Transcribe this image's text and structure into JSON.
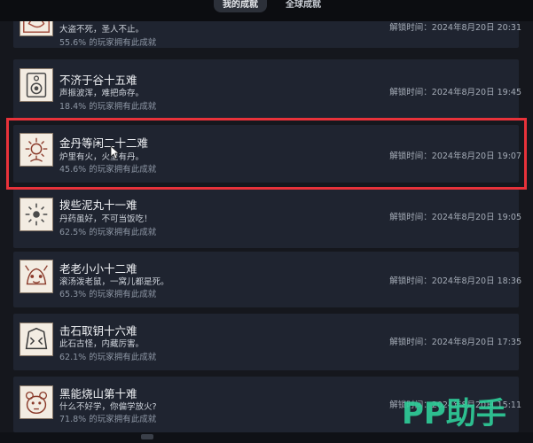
{
  "tabs": {
    "mine": "我的成就",
    "global": "全球成就"
  },
  "achievements": [
    {
      "title": "",
      "desc": "大盗不死，圣人不止。",
      "pct": "55.6% 的玩家拥有此成就",
      "unlock": "解锁时间：2024年8月20日 20:31",
      "icon": "thief-emblem-icon"
    },
    {
      "title": "不济于谷十五难",
      "desc": "声振波浑，难把命存。",
      "pct": "18.4% 的玩家拥有此成就",
      "unlock": "解锁时间：2024年8月20日 19:45",
      "icon": "speaker-emblem-icon"
    },
    {
      "title": "金丹等闲二十二难",
      "desc": "炉里有火，火里有丹。",
      "pct": "45.6% 的玩家拥有此成就",
      "unlock": "解锁时间：2024年8月20日 19:07",
      "icon": "furnace-flame-icon"
    },
    {
      "title": "拨些泥丸十一难",
      "desc": "丹药虽好，不可当饭吃！",
      "pct": "62.5% 的玩家拥有此成就",
      "unlock": "解锁时间：2024年8月20日 19:05",
      "icon": "pill-burst-icon"
    },
    {
      "title": "老老小小十二难",
      "desc": "滚汤泼老鼠，一窝儿都是死。",
      "pct": "65.3% 的玩家拥有此成就",
      "unlock": "解锁时间：2024年8月20日 18:36",
      "icon": "rat-emblem-icon"
    },
    {
      "title": "击石取钥十六难",
      "desc": "此石古怪，内藏厉害。",
      "pct": "62.1% 的玩家拥有此成就",
      "unlock": "解锁时间：2024年8月20日 17:35",
      "icon": "stone-mask-icon"
    },
    {
      "title": "黑能烧山第十难",
      "desc": "什么不好学，你偏学放火?",
      "pct": "71.8% 的玩家拥有此成就",
      "unlock": "解锁时间：2024年8月20日 15:11",
      "icon": "bear-emblem-icon"
    }
  ],
  "watermark": "PP助手",
  "colors": {
    "highlight": "#e8323a",
    "watermark": "#2fcf9a"
  }
}
